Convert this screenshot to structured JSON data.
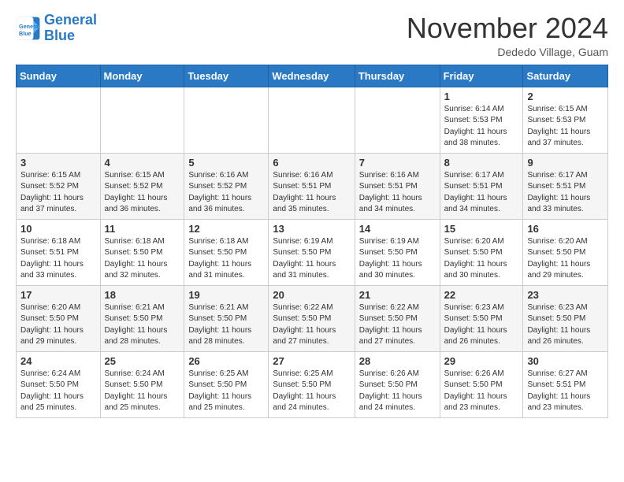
{
  "header": {
    "logo_line1": "General",
    "logo_line2": "Blue",
    "month": "November 2024",
    "location": "Dededo Village, Guam"
  },
  "weekdays": [
    "Sunday",
    "Monday",
    "Tuesday",
    "Wednesday",
    "Thursday",
    "Friday",
    "Saturday"
  ],
  "weeks": [
    [
      {
        "day": "",
        "info": ""
      },
      {
        "day": "",
        "info": ""
      },
      {
        "day": "",
        "info": ""
      },
      {
        "day": "",
        "info": ""
      },
      {
        "day": "",
        "info": ""
      },
      {
        "day": "1",
        "info": "Sunrise: 6:14 AM\nSunset: 5:53 PM\nDaylight: 11 hours and 38 minutes."
      },
      {
        "day": "2",
        "info": "Sunrise: 6:15 AM\nSunset: 5:53 PM\nDaylight: 11 hours and 37 minutes."
      }
    ],
    [
      {
        "day": "3",
        "info": "Sunrise: 6:15 AM\nSunset: 5:52 PM\nDaylight: 11 hours and 37 minutes."
      },
      {
        "day": "4",
        "info": "Sunrise: 6:15 AM\nSunset: 5:52 PM\nDaylight: 11 hours and 36 minutes."
      },
      {
        "day": "5",
        "info": "Sunrise: 6:16 AM\nSunset: 5:52 PM\nDaylight: 11 hours and 36 minutes."
      },
      {
        "day": "6",
        "info": "Sunrise: 6:16 AM\nSunset: 5:51 PM\nDaylight: 11 hours and 35 minutes."
      },
      {
        "day": "7",
        "info": "Sunrise: 6:16 AM\nSunset: 5:51 PM\nDaylight: 11 hours and 34 minutes."
      },
      {
        "day": "8",
        "info": "Sunrise: 6:17 AM\nSunset: 5:51 PM\nDaylight: 11 hours and 34 minutes."
      },
      {
        "day": "9",
        "info": "Sunrise: 6:17 AM\nSunset: 5:51 PM\nDaylight: 11 hours and 33 minutes."
      }
    ],
    [
      {
        "day": "10",
        "info": "Sunrise: 6:18 AM\nSunset: 5:51 PM\nDaylight: 11 hours and 33 minutes."
      },
      {
        "day": "11",
        "info": "Sunrise: 6:18 AM\nSunset: 5:50 PM\nDaylight: 11 hours and 32 minutes."
      },
      {
        "day": "12",
        "info": "Sunrise: 6:18 AM\nSunset: 5:50 PM\nDaylight: 11 hours and 31 minutes."
      },
      {
        "day": "13",
        "info": "Sunrise: 6:19 AM\nSunset: 5:50 PM\nDaylight: 11 hours and 31 minutes."
      },
      {
        "day": "14",
        "info": "Sunrise: 6:19 AM\nSunset: 5:50 PM\nDaylight: 11 hours and 30 minutes."
      },
      {
        "day": "15",
        "info": "Sunrise: 6:20 AM\nSunset: 5:50 PM\nDaylight: 11 hours and 30 minutes."
      },
      {
        "day": "16",
        "info": "Sunrise: 6:20 AM\nSunset: 5:50 PM\nDaylight: 11 hours and 29 minutes."
      }
    ],
    [
      {
        "day": "17",
        "info": "Sunrise: 6:20 AM\nSunset: 5:50 PM\nDaylight: 11 hours and 29 minutes."
      },
      {
        "day": "18",
        "info": "Sunrise: 6:21 AM\nSunset: 5:50 PM\nDaylight: 11 hours and 28 minutes."
      },
      {
        "day": "19",
        "info": "Sunrise: 6:21 AM\nSunset: 5:50 PM\nDaylight: 11 hours and 28 minutes."
      },
      {
        "day": "20",
        "info": "Sunrise: 6:22 AM\nSunset: 5:50 PM\nDaylight: 11 hours and 27 minutes."
      },
      {
        "day": "21",
        "info": "Sunrise: 6:22 AM\nSunset: 5:50 PM\nDaylight: 11 hours and 27 minutes."
      },
      {
        "day": "22",
        "info": "Sunrise: 6:23 AM\nSunset: 5:50 PM\nDaylight: 11 hours and 26 minutes."
      },
      {
        "day": "23",
        "info": "Sunrise: 6:23 AM\nSunset: 5:50 PM\nDaylight: 11 hours and 26 minutes."
      }
    ],
    [
      {
        "day": "24",
        "info": "Sunrise: 6:24 AM\nSunset: 5:50 PM\nDaylight: 11 hours and 25 minutes."
      },
      {
        "day": "25",
        "info": "Sunrise: 6:24 AM\nSunset: 5:50 PM\nDaylight: 11 hours and 25 minutes."
      },
      {
        "day": "26",
        "info": "Sunrise: 6:25 AM\nSunset: 5:50 PM\nDaylight: 11 hours and 25 minutes."
      },
      {
        "day": "27",
        "info": "Sunrise: 6:25 AM\nSunset: 5:50 PM\nDaylight: 11 hours and 24 minutes."
      },
      {
        "day": "28",
        "info": "Sunrise: 6:26 AM\nSunset: 5:50 PM\nDaylight: 11 hours and 24 minutes."
      },
      {
        "day": "29",
        "info": "Sunrise: 6:26 AM\nSunset: 5:50 PM\nDaylight: 11 hours and 23 minutes."
      },
      {
        "day": "30",
        "info": "Sunrise: 6:27 AM\nSunset: 5:51 PM\nDaylight: 11 hours and 23 minutes."
      }
    ]
  ]
}
